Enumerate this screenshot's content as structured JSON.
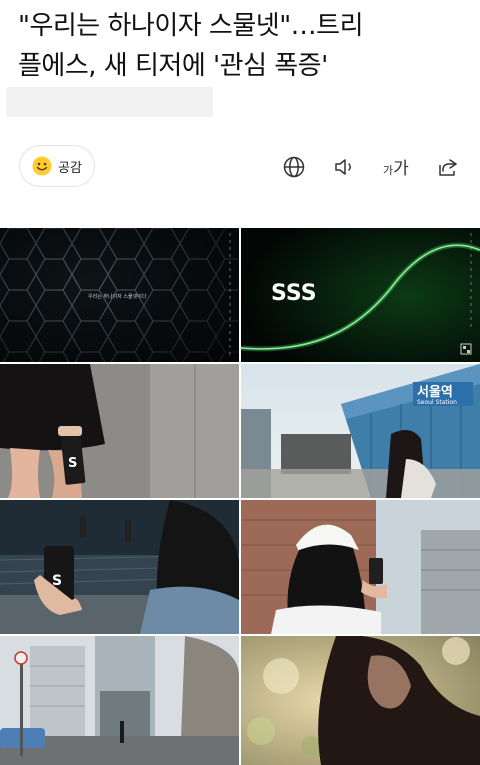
{
  "article": {
    "headline_line1": "\"우리는 하나이자 스물넷\"…트리",
    "headline_line2": "플에스, 새 티저에 '관심 폭증'"
  },
  "toolbar": {
    "like_label": "공감",
    "font_small": "가",
    "font_large": "가"
  },
  "icons": {
    "like": "smile-emoji-icon",
    "language": "globe-icon",
    "tts": "speaker-icon",
    "font_size": "font-size-icon",
    "share": "share-icon"
  },
  "teaser": {
    "tile1_caption": "우리는 하나이자 스물넷이다",
    "tile2_text": "SSS",
    "tile5_sign_hangul": "서울역",
    "tile5_sign_english": "Seoul Station",
    "phone_text": "S"
  },
  "colors": {
    "accent_green": "#4fe06a",
    "sign_blue": "#2d6fa8"
  }
}
